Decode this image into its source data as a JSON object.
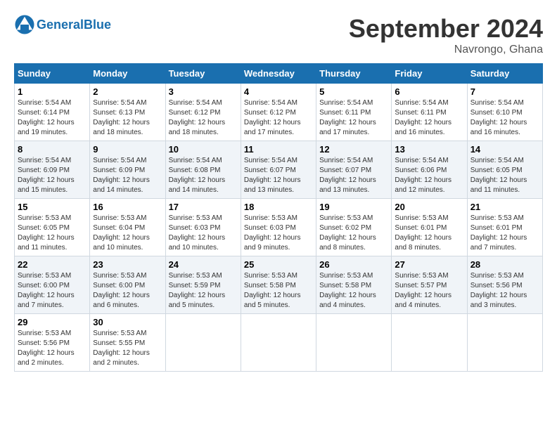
{
  "logo": {
    "text_general": "General",
    "text_blue": "Blue"
  },
  "title": "September 2024",
  "location": "Navrongo, Ghana",
  "days_of_week": [
    "Sunday",
    "Monday",
    "Tuesday",
    "Wednesday",
    "Thursday",
    "Friday",
    "Saturday"
  ],
  "weeks": [
    [
      {
        "day": "1",
        "sunrise": "5:54 AM",
        "sunset": "6:14 PM",
        "daylight": "12 hours and 19 minutes."
      },
      {
        "day": "2",
        "sunrise": "5:54 AM",
        "sunset": "6:13 PM",
        "daylight": "12 hours and 18 minutes."
      },
      {
        "day": "3",
        "sunrise": "5:54 AM",
        "sunset": "6:12 PM",
        "daylight": "12 hours and 18 minutes."
      },
      {
        "day": "4",
        "sunrise": "5:54 AM",
        "sunset": "6:12 PM",
        "daylight": "12 hours and 17 minutes."
      },
      {
        "day": "5",
        "sunrise": "5:54 AM",
        "sunset": "6:11 PM",
        "daylight": "12 hours and 17 minutes."
      },
      {
        "day": "6",
        "sunrise": "5:54 AM",
        "sunset": "6:11 PM",
        "daylight": "12 hours and 16 minutes."
      },
      {
        "day": "7",
        "sunrise": "5:54 AM",
        "sunset": "6:10 PM",
        "daylight": "12 hours and 16 minutes."
      }
    ],
    [
      {
        "day": "8",
        "sunrise": "5:54 AM",
        "sunset": "6:09 PM",
        "daylight": "12 hours and 15 minutes."
      },
      {
        "day": "9",
        "sunrise": "5:54 AM",
        "sunset": "6:09 PM",
        "daylight": "12 hours and 14 minutes."
      },
      {
        "day": "10",
        "sunrise": "5:54 AM",
        "sunset": "6:08 PM",
        "daylight": "12 hours and 14 minutes."
      },
      {
        "day": "11",
        "sunrise": "5:54 AM",
        "sunset": "6:07 PM",
        "daylight": "12 hours and 13 minutes."
      },
      {
        "day": "12",
        "sunrise": "5:54 AM",
        "sunset": "6:07 PM",
        "daylight": "12 hours and 13 minutes."
      },
      {
        "day": "13",
        "sunrise": "5:54 AM",
        "sunset": "6:06 PM",
        "daylight": "12 hours and 12 minutes."
      },
      {
        "day": "14",
        "sunrise": "5:54 AM",
        "sunset": "6:05 PM",
        "daylight": "12 hours and 11 minutes."
      }
    ],
    [
      {
        "day": "15",
        "sunrise": "5:53 AM",
        "sunset": "6:05 PM",
        "daylight": "12 hours and 11 minutes."
      },
      {
        "day": "16",
        "sunrise": "5:53 AM",
        "sunset": "6:04 PM",
        "daylight": "12 hours and 10 minutes."
      },
      {
        "day": "17",
        "sunrise": "5:53 AM",
        "sunset": "6:03 PM",
        "daylight": "12 hours and 10 minutes."
      },
      {
        "day": "18",
        "sunrise": "5:53 AM",
        "sunset": "6:03 PM",
        "daylight": "12 hours and 9 minutes."
      },
      {
        "day": "19",
        "sunrise": "5:53 AM",
        "sunset": "6:02 PM",
        "daylight": "12 hours and 8 minutes."
      },
      {
        "day": "20",
        "sunrise": "5:53 AM",
        "sunset": "6:01 PM",
        "daylight": "12 hours and 8 minutes."
      },
      {
        "day": "21",
        "sunrise": "5:53 AM",
        "sunset": "6:01 PM",
        "daylight": "12 hours and 7 minutes."
      }
    ],
    [
      {
        "day": "22",
        "sunrise": "5:53 AM",
        "sunset": "6:00 PM",
        "daylight": "12 hours and 7 minutes."
      },
      {
        "day": "23",
        "sunrise": "5:53 AM",
        "sunset": "6:00 PM",
        "daylight": "12 hours and 6 minutes."
      },
      {
        "day": "24",
        "sunrise": "5:53 AM",
        "sunset": "5:59 PM",
        "daylight": "12 hours and 5 minutes."
      },
      {
        "day": "25",
        "sunrise": "5:53 AM",
        "sunset": "5:58 PM",
        "daylight": "12 hours and 5 minutes."
      },
      {
        "day": "26",
        "sunrise": "5:53 AM",
        "sunset": "5:58 PM",
        "daylight": "12 hours and 4 minutes."
      },
      {
        "day": "27",
        "sunrise": "5:53 AM",
        "sunset": "5:57 PM",
        "daylight": "12 hours and 4 minutes."
      },
      {
        "day": "28",
        "sunrise": "5:53 AM",
        "sunset": "5:56 PM",
        "daylight": "12 hours and 3 minutes."
      }
    ],
    [
      {
        "day": "29",
        "sunrise": "5:53 AM",
        "sunset": "5:56 PM",
        "daylight": "12 hours and 2 minutes."
      },
      {
        "day": "30",
        "sunrise": "5:53 AM",
        "sunset": "5:55 PM",
        "daylight": "12 hours and 2 minutes."
      },
      null,
      null,
      null,
      null,
      null
    ]
  ]
}
